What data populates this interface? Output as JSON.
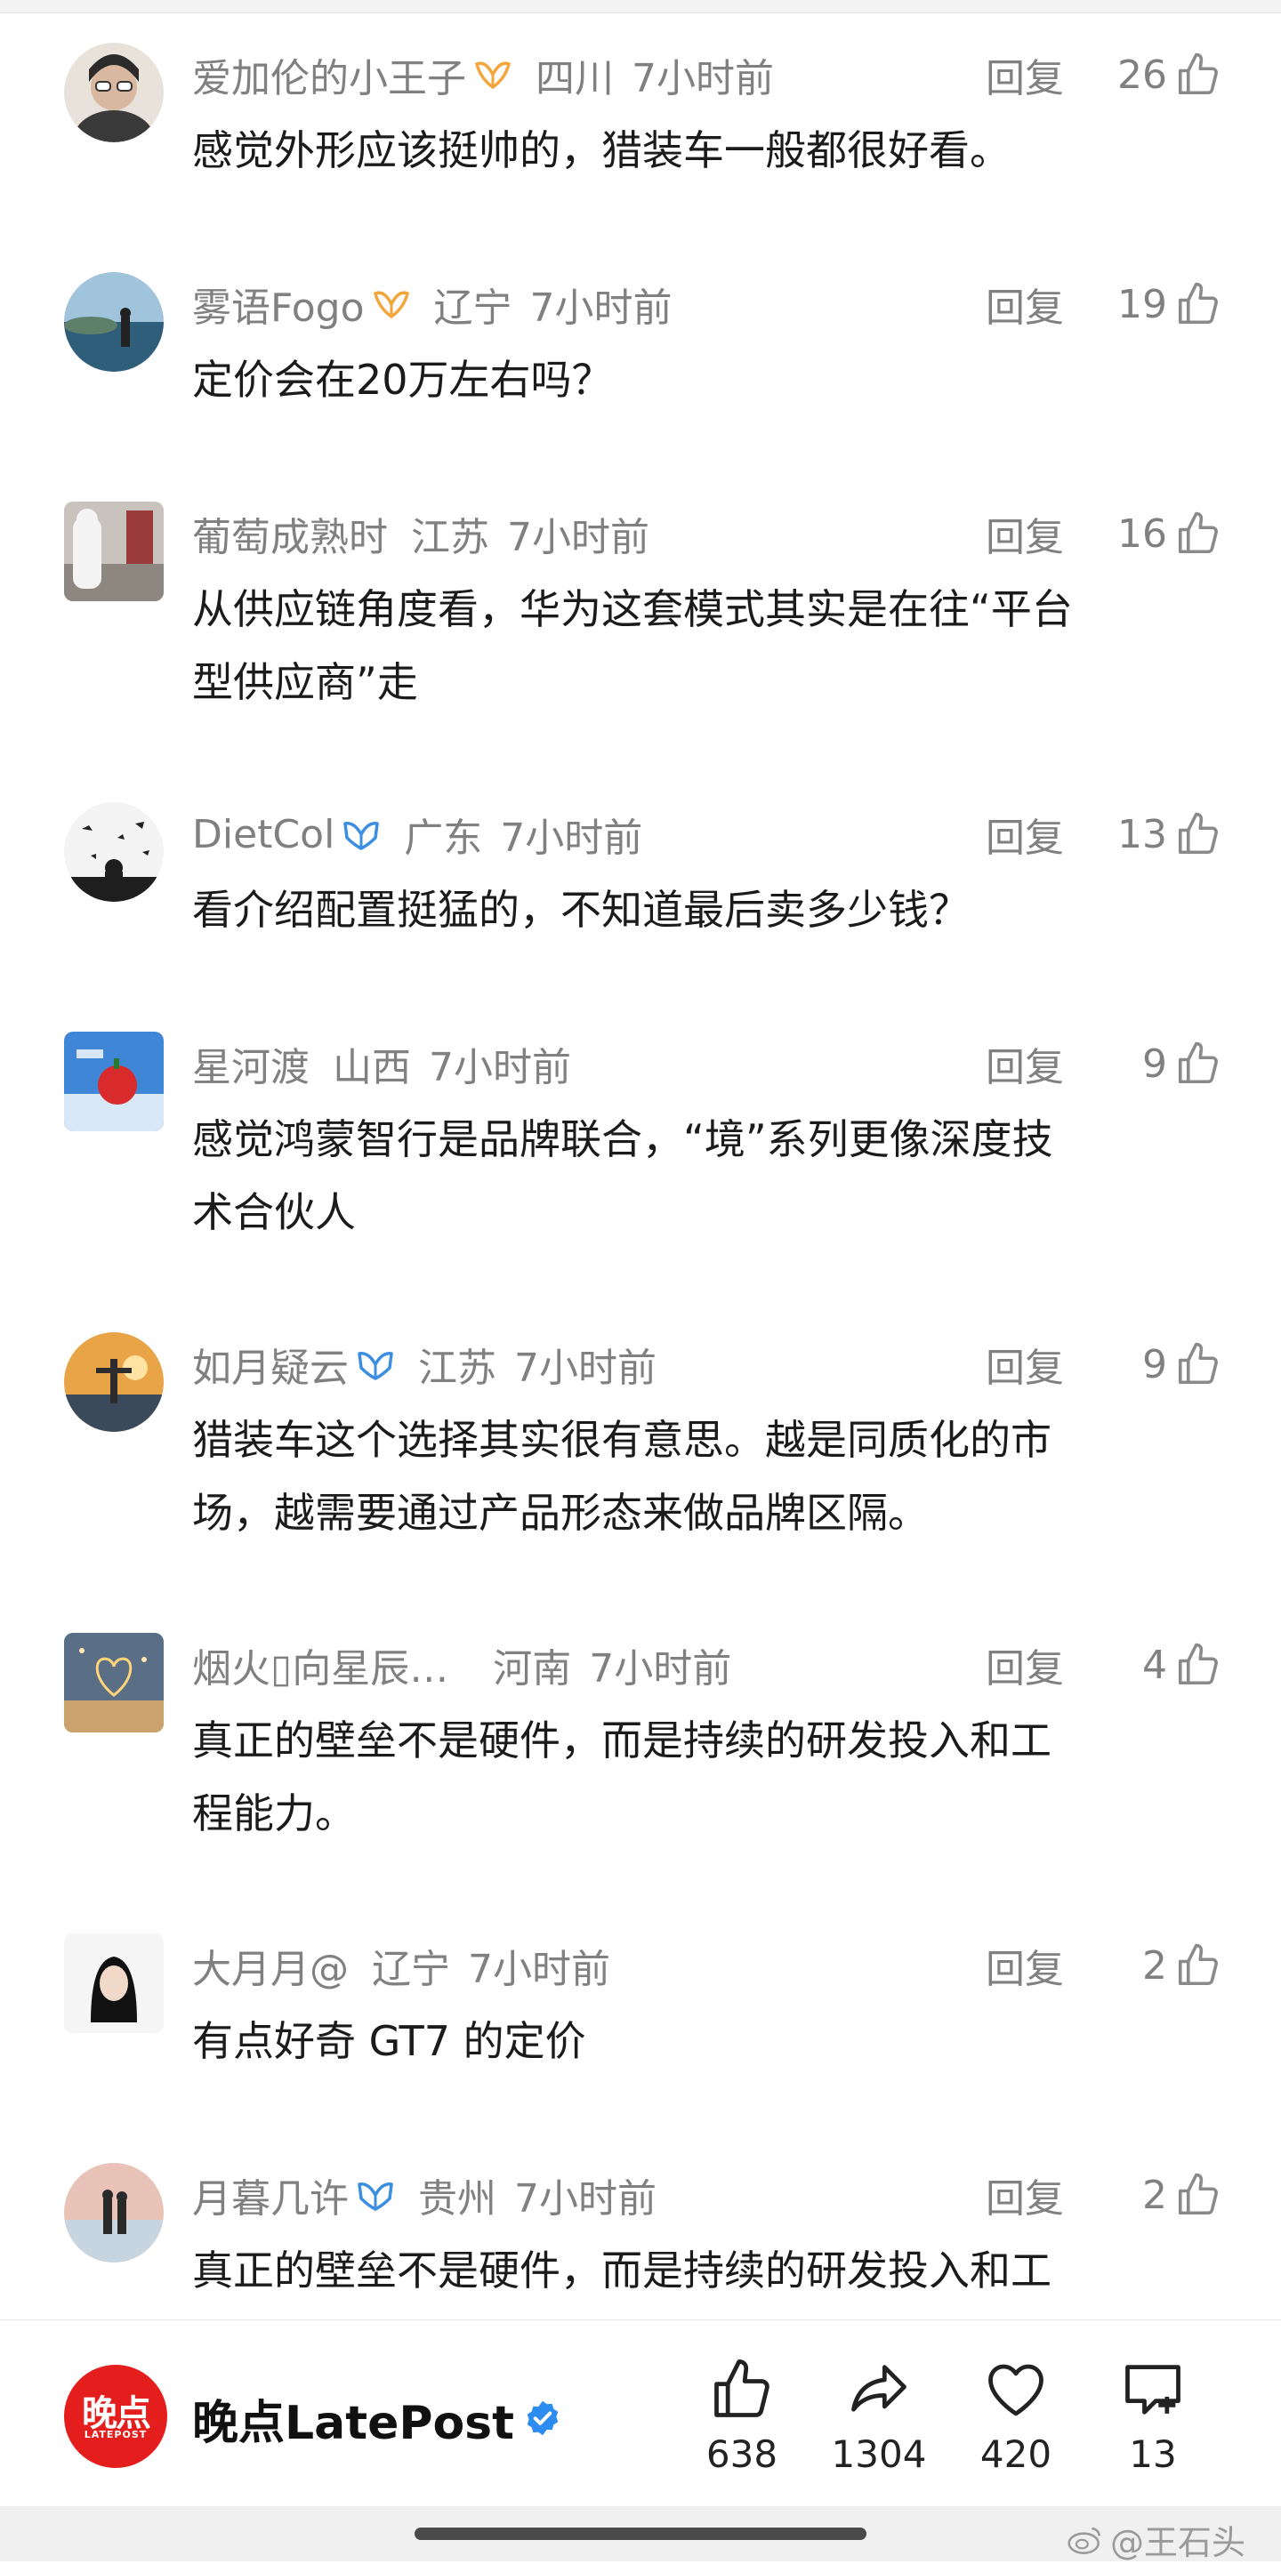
{
  "reply_label": "回复",
  "comments": [
    {
      "username": "爱加伦的小王子",
      "badge": "gold",
      "region": "四川",
      "time": "7小时前",
      "likes": "26",
      "text": "感觉外形应该挺帅的，猎装车一般都很好看。"
    },
    {
      "username": "雾语Fogo",
      "badge": "gold",
      "region": "辽宁",
      "time": "7小时前",
      "likes": "19",
      "text": "定价会在20万左右吗？"
    },
    {
      "username": "葡萄成熟时",
      "badge": "",
      "region": "江苏",
      "time": "7小时前",
      "likes": "16",
      "text": "从供应链角度看，华为这套模式其实是在往“平台\n型供应商”走"
    },
    {
      "username": "DietCol",
      "badge": "blue",
      "region": "广东",
      "time": "7小时前",
      "likes": "13",
      "text": "看介绍配置挺猛的，不知道最后卖多少钱？"
    },
    {
      "username": "星河渡",
      "badge": "",
      "region": "山西",
      "time": "7小时前",
      "likes": "9",
      "text": "感觉鸿蒙智行是品牌联合，“境”系列更像深度技\n术合伙人"
    },
    {
      "username": "如月疑云",
      "badge": "blue",
      "region": "江苏",
      "time": "7小时前",
      "likes": "9",
      "text": "猎装车这个选择其实很有意思。越是同质化的市\n场，越需要通过产品形态来做品牌区隔。"
    },
    {
      "username": "烟火▯向星辰…",
      "badge": "",
      "region": "河南",
      "time": "7小时前",
      "likes": "4",
      "text": "真正的壁垒不是硬件，而是持续的研发投入和工\n程能力。"
    },
    {
      "username": "大月月@",
      "badge": "",
      "region": "辽宁",
      "time": "7小时前",
      "likes": "2",
      "text": "有点好奇 GT7 的定价"
    },
    {
      "username": "月暮几许",
      "badge": "blue",
      "region": "贵州",
      "time": "7小时前",
      "likes": "2",
      "text": "真正的壁垒不是硬件，而是持续的研发投入和工\n程能力。"
    }
  ],
  "footer": {
    "logo_cn": "晚点",
    "logo_en": "LATEPOST",
    "publisher": "晚点LatePost",
    "stats": {
      "like": "638",
      "share": "1304",
      "favorite": "420",
      "comment": "13"
    }
  },
  "watermark": "@王石头",
  "colors": {
    "accent_red": "#e41d1d",
    "verified_blue": "#2d8cf0",
    "badge_gold": "#f2a63b",
    "badge_blue": "#3c8fe0",
    "meta_gray": "#808080"
  },
  "icons": [
    "thumb-up-icon",
    "share-arrow-icon",
    "heart-icon",
    "comment-plus-icon",
    "verified-check-icon",
    "weibo-icon"
  ]
}
